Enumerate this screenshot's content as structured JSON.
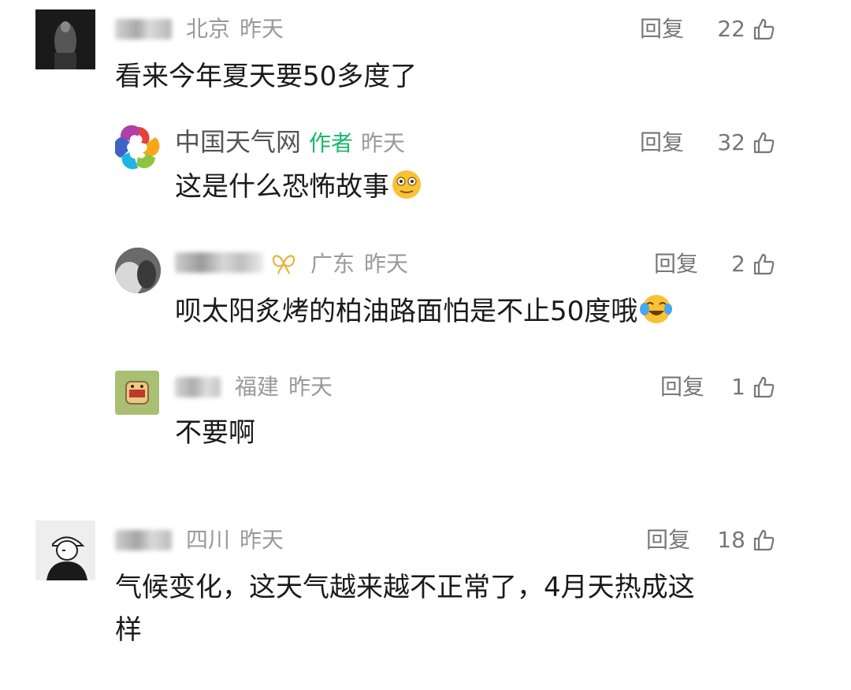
{
  "comments": [
    {
      "region": "北京",
      "time": "昨天",
      "reply_label": "回复",
      "likes": "22",
      "content": "看来今年夏天要50多度了",
      "avatar_icon": "dark-figure-avatar",
      "replies": [
        {
          "author": "中国天气网",
          "author_tag": "作者",
          "time": "昨天",
          "reply_label": "回复",
          "likes": "32",
          "content": "这是什么恐怖故事",
          "content_emoji": "nervous-face-emoji",
          "avatar_icon": "rainbow-swirl-logo-avatar"
        },
        {
          "region": "广东",
          "time": "昨天",
          "reply_label": "回复",
          "likes": "2",
          "content": "呗太阳炙烤的柏油路面怕是不止50度哦",
          "content_emoji": "crying-laughing-emoji",
          "badge_icon": "butterfly-badge-icon",
          "avatar_icon": "dark-photo-avatar"
        },
        {
          "region": "福建",
          "time": "昨天",
          "reply_label": "回复",
          "likes": "1",
          "content": "不要啊",
          "avatar_icon": "cartoon-toast-avatar"
        }
      ]
    },
    {
      "region": "四川",
      "time": "昨天",
      "reply_label": "回复",
      "likes": "18",
      "content_line1": "气候变化，这天气越来越不正常了，4月天热成这",
      "content_line2": "样",
      "avatar_icon": "cap-person-sketch-avatar"
    }
  ],
  "colors": {
    "author_tag": "#17b86a",
    "meta": "#9a9a9a",
    "action": "#777777"
  }
}
